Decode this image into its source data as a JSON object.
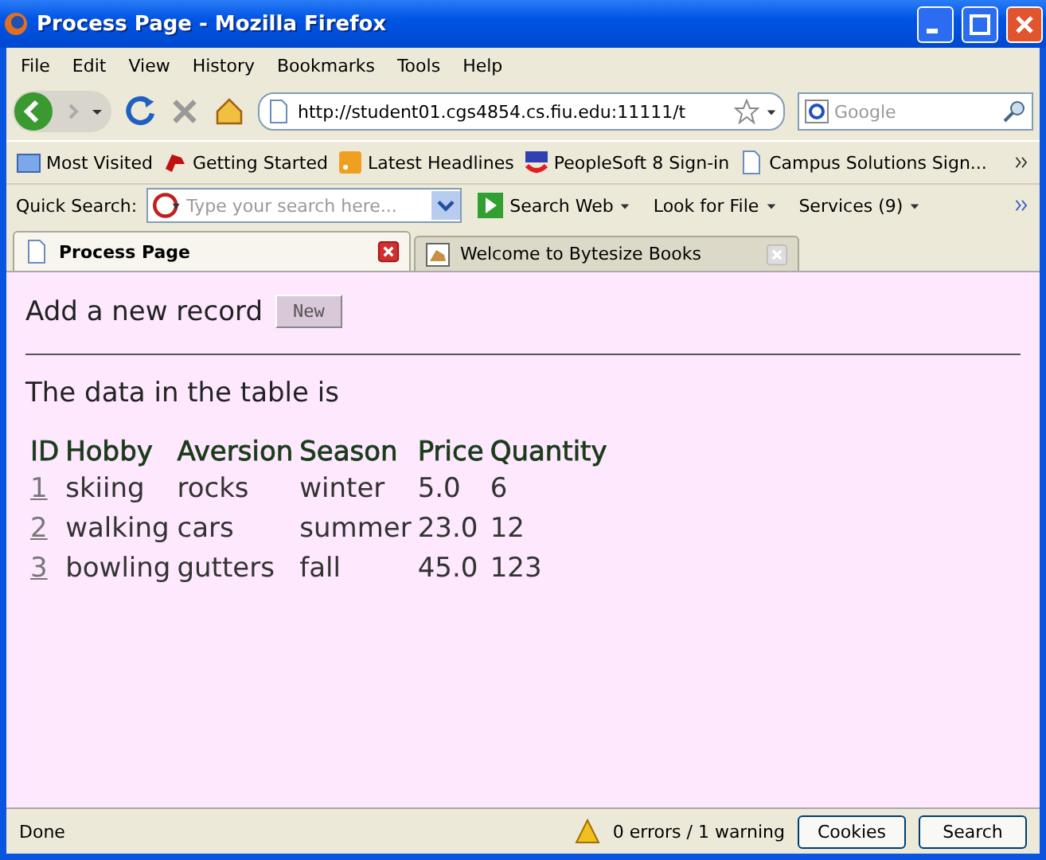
{
  "window": {
    "title": "Process Page - Mozilla Firefox"
  },
  "menu": [
    "File",
    "Edit",
    "View",
    "History",
    "Bookmarks",
    "Tools",
    "Help"
  ],
  "navigation": {
    "url": "http://student01.cgs4854.cs.fiu.edu:11111/t",
    "search_placeholder": "Google"
  },
  "bookmarks": [
    {
      "label": "Most Visited",
      "kind": "folder"
    },
    {
      "label": "Getting Started",
      "kind": "bird"
    },
    {
      "label": "Latest Headlines",
      "kind": "feed"
    },
    {
      "label": "PeopleSoft 8 Sign-in",
      "kind": "logo"
    },
    {
      "label": "Campus Solutions Sign...",
      "kind": "page"
    }
  ],
  "quick_search": {
    "label": "Quick Search:",
    "placeholder": "Type your search here...",
    "buttons": [
      "Search Web",
      "Look for File",
      "Services (9)"
    ]
  },
  "tabs": [
    {
      "label": "Process Page",
      "selected": true
    },
    {
      "label": "Welcome to Bytesize Books",
      "selected": false
    }
  ],
  "page": {
    "add_label": "Add a new record",
    "new_button": "New",
    "intro": "The data in the table is",
    "table": {
      "columns": [
        "ID",
        "Hobby",
        "Aversion",
        "Season",
        "Price",
        "Quantity"
      ],
      "rows": [
        [
          "1",
          "skiing",
          "rocks",
          "winter",
          "5.0",
          "6"
        ],
        [
          "2",
          "walking",
          "cars",
          "summer",
          "23.0",
          "12"
        ],
        [
          "3",
          "bowling",
          "gutters",
          "fall",
          "45.0",
          "123"
        ]
      ]
    }
  },
  "status_bar": {
    "text": "Done",
    "warnings": "0 errors / 1 warning",
    "buttons": [
      "Cookies",
      "Search"
    ]
  }
}
